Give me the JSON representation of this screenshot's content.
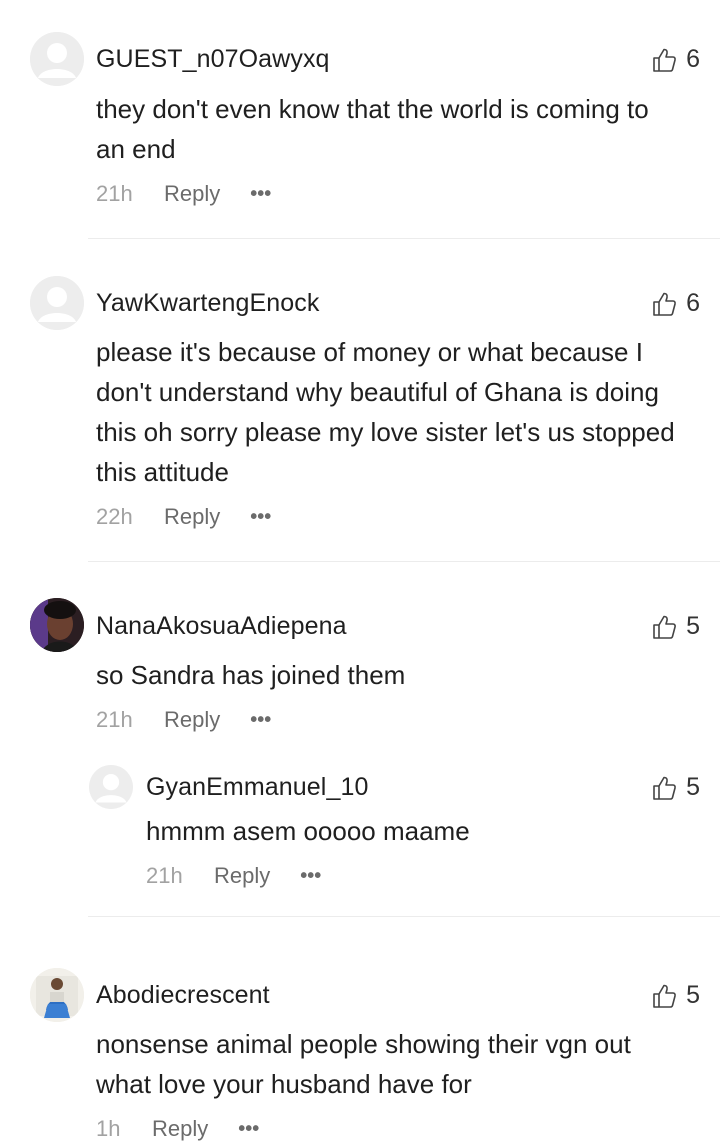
{
  "comments": [
    {
      "user": "GUEST_n07Oawyxq",
      "likes": "6",
      "text_lines": [
        "they don't even know that the world is coming to",
        "an end"
      ],
      "time": "21h",
      "reply_label": "Reply",
      "more_label": "•••"
    },
    {
      "user": "YawKwartengEnock",
      "likes": "6",
      "text_lines": [
        "please it's because of money or what because I",
        "don't understand why beautiful of Ghana is doing",
        "this oh sorry please my love sister let's us stopped",
        "this attitude"
      ],
      "time": "22h",
      "reply_label": "Reply",
      "more_label": "•••"
    },
    {
      "user": "NanaAkosuaAdiepena",
      "likes": "5",
      "text_lines": [
        "so Sandra has joined them"
      ],
      "time": "21h",
      "reply_label": "Reply",
      "more_label": "•••",
      "replies": [
        {
          "user": "GyanEmmanuel_10",
          "likes": "5",
          "text_lines": [
            "hmmm asem ooooo maame"
          ],
          "time": "21h",
          "reply_label": "Reply",
          "more_label": "•••"
        }
      ]
    },
    {
      "user": "Abodiecrescent",
      "likes": "5",
      "text_lines": [
        "nonsense animal people showing their vgn out",
        "what love your husband have for"
      ],
      "time": "1h",
      "reply_label": "Reply",
      "more_label": "•••"
    }
  ],
  "icons": {
    "like": "thumbs-up-icon",
    "avatar_default": "default-avatar-icon"
  },
  "colors": {
    "time": "#a2a2a2",
    "action": "#6b6b6b",
    "divider": "#ececec"
  }
}
